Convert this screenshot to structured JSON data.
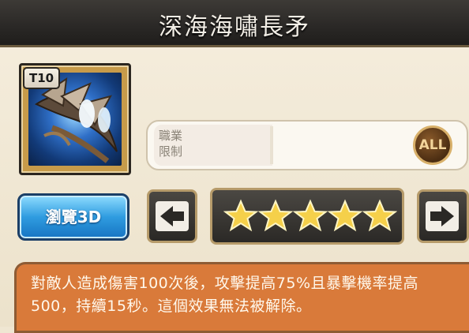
{
  "header": {
    "title": "深海海嘯長矛"
  },
  "item": {
    "tier": "T10",
    "art_icon": "trident-icon",
    "frame_color": "#c79b4a"
  },
  "class_restriction": {
    "label": "職業\n限制",
    "badge": "ALL"
  },
  "buttons": {
    "view3d_label": "瀏覽3D",
    "prev_icon": "arrow-left-icon",
    "next_icon": "arrow-right-icon"
  },
  "rarity": {
    "stars": 5,
    "max_stars": 5,
    "star_color": "#f5d04a"
  },
  "description": {
    "text": "對敵人造成傷害100次後，攻擊提高75%且暴擊機率提高500，持續15秒。這個效果無法被解除。"
  },
  "colors": {
    "accent_blue": "#2f9ce0",
    "description_bg": "#d97a3a",
    "header_bg": "#2a2826"
  }
}
